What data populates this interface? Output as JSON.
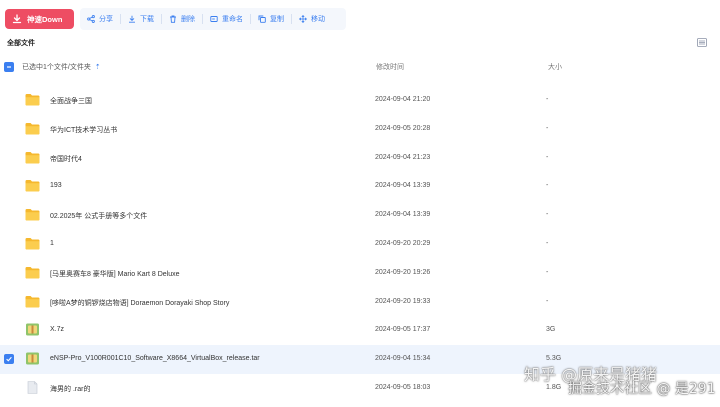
{
  "toolbar": {
    "primary_label": "神速Down",
    "actions": [
      {
        "label": "分享",
        "icon": "share-icon"
      },
      {
        "label": "下载",
        "icon": "download-icon"
      },
      {
        "label": "删除",
        "icon": "trash-icon"
      },
      {
        "label": "重命名",
        "icon": "rename-icon"
      },
      {
        "label": "复制",
        "icon": "copy-icon"
      },
      {
        "label": "移动",
        "icon": "move-icon"
      }
    ]
  },
  "breadcrumb": "全部文件",
  "table": {
    "selection_label": "已选中1个文件/文件夹",
    "col_date": "修改时间",
    "col_size": "大小"
  },
  "files": [
    {
      "name": "全面战争三国",
      "date": "2024-09-04 21:20",
      "size": "-",
      "type": "folder",
      "selected": false
    },
    {
      "name": "华为ICT技术学习丛书",
      "date": "2024-09-05 20:28",
      "size": "-",
      "type": "folder",
      "selected": false
    },
    {
      "name": "帝国时代4",
      "date": "2024-09-04 21:23",
      "size": "-",
      "type": "folder",
      "selected": false
    },
    {
      "name": "193",
      "date": "2024-09-04 13:39",
      "size": "-",
      "type": "folder",
      "selected": false
    },
    {
      "name": "02.2025年 公式手册等多个文件",
      "date": "2024-09-04 13:39",
      "size": "-",
      "type": "folder",
      "selected": false
    },
    {
      "name": "1",
      "date": "2024-09-20 20:29",
      "size": "-",
      "type": "folder",
      "selected": false
    },
    {
      "name": "[马里奥赛车8 豪华版] Mario Kart 8 Deluxe",
      "date": "2024-09-20 19:26",
      "size": "-",
      "type": "folder",
      "selected": false
    },
    {
      "name": "[哆啦A梦的铜锣烧店物语] Doraemon Dorayaki Shop Story",
      "date": "2024-09-20 19:33",
      "size": "-",
      "type": "folder",
      "selected": false
    },
    {
      "name": "X.7z",
      "date": "2024-09-05 17:37",
      "size": "3G",
      "type": "archive",
      "selected": false
    },
    {
      "name": "eNSP-Pro_V100R001C10_Software_X8664_VirtualBox_release.tar",
      "date": "2024-09-04 15:34",
      "size": "5.3G",
      "type": "archive",
      "selected": true
    },
    {
      "name": "海男的 .rar的",
      "date": "2024-09-05 18:03",
      "size": "1.8G",
      "type": "file",
      "selected": false
    }
  ],
  "watermark": {
    "line1": "知乎 @原来是猪猪",
    "line2": "掘金技术社区 @ 是291"
  }
}
